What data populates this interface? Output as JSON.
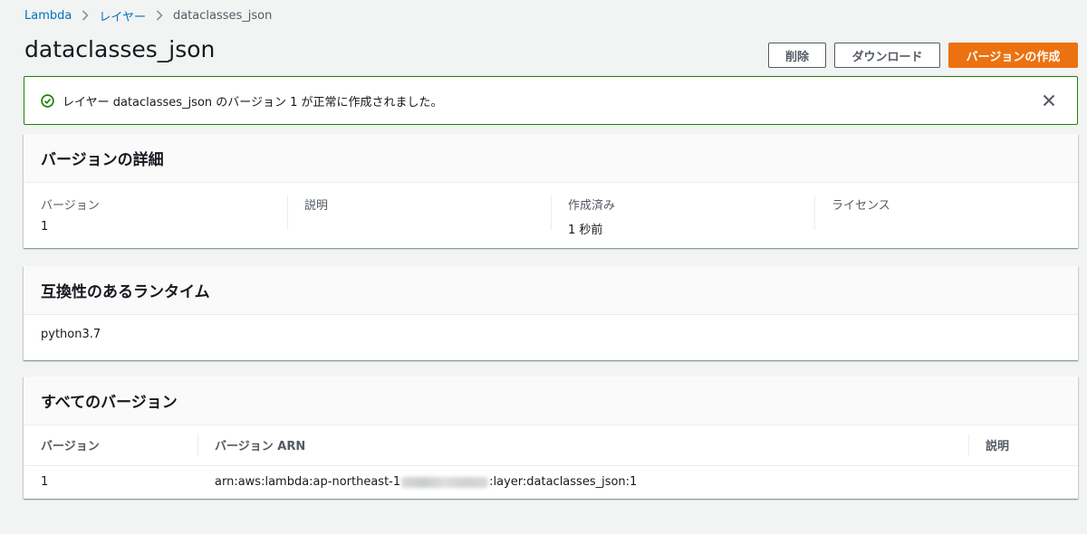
{
  "breadcrumb": {
    "items": [
      "Lambda",
      "レイヤー"
    ],
    "current": "dataclasses_json"
  },
  "page": {
    "title": "dataclasses_json"
  },
  "actions": {
    "delete_label": "削除",
    "download_label": "ダウンロード",
    "create_version_label": "バージョンの作成"
  },
  "flash": {
    "message": "レイヤー dataclasses_json のバージョン 1 が正常に作成されました。",
    "status_color": "#1d8102"
  },
  "version_details": {
    "header": "バージョンの詳細",
    "fields": [
      {
        "label": "バージョン",
        "value": "1"
      },
      {
        "label": "説明",
        "value": ""
      },
      {
        "label": "作成済み",
        "value": "1 秒前"
      },
      {
        "label": "ライセンス",
        "value": ""
      }
    ]
  },
  "runtimes": {
    "header": "互換性のあるランタイム",
    "items": [
      "python3.7"
    ]
  },
  "all_versions": {
    "header": "すべてのバージョン",
    "columns": [
      "バージョン",
      "バージョン ARN",
      "説明"
    ],
    "rows": [
      {
        "version": "1",
        "arn_prefix": "arn:aws:lambda:ap-northeast-1",
        "arn_suffix": ":layer:dataclasses_json:1",
        "description": ""
      }
    ]
  },
  "colors": {
    "accent": "#ec7211",
    "link": "#0073bb",
    "success": "#1d8102"
  }
}
